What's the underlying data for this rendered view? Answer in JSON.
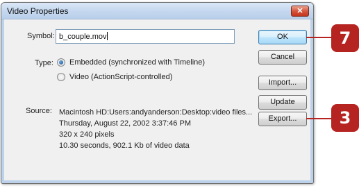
{
  "window": {
    "title": "Video Properties",
    "close_glyph": "✕"
  },
  "symbol": {
    "label": "Symbol:",
    "value": "b_couple.mov"
  },
  "type": {
    "label": "Type:",
    "options": [
      {
        "label": "Embedded (synchronized with Timeline)",
        "checked": true
      },
      {
        "label": "Video (ActionScript-controlled)",
        "checked": false
      }
    ]
  },
  "source": {
    "label": "Source:",
    "lines": [
      "Macintosh HD:Users:andyanderson:Desktop:video files...",
      "Thursday, August 22, 2002  3:37:46 PM",
      "320 x 240 pixels",
      "10.30 seconds, 902.1 Kb of video data"
    ]
  },
  "buttons": {
    "ok": "OK",
    "cancel": "Cancel",
    "import": "Import...",
    "update": "Update",
    "export": "Export..."
  },
  "callouts": [
    {
      "number": "7"
    },
    {
      "number": "3"
    }
  ],
  "colors": {
    "callout": "#b62421",
    "title_bar": "#c5d8ef"
  }
}
